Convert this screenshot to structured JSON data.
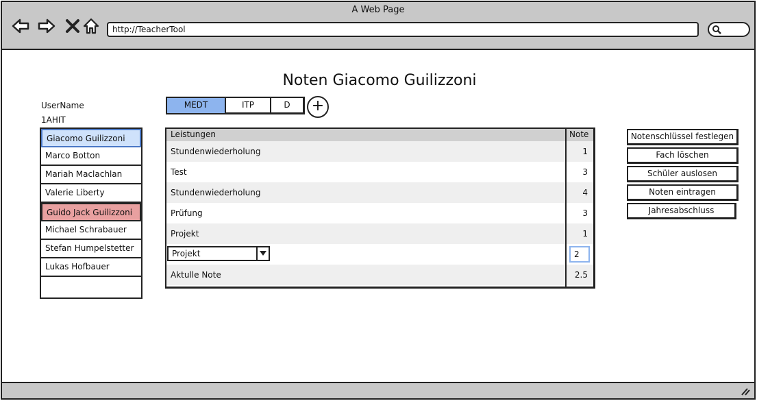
{
  "window": {
    "title": "A Web Page"
  },
  "browser": {
    "url": "http://TeacherTool"
  },
  "page": {
    "title": "Noten Giacomo Guilizzoni"
  },
  "user": {
    "name": "UserName",
    "class": "1AHIT"
  },
  "students": [
    "Giacomo Guilizzoni",
    "Marco Botton",
    "Mariah Maclachlan",
    "Valerie Liberty",
    "Guido Jack Guilizzoni",
    "Michael Schrabauer",
    "Stefan Humpelstetter",
    "Lukas Hofbauer",
    ""
  ],
  "tabs": [
    "MEDT",
    "ITP",
    "D"
  ],
  "add_tab_label": "+",
  "grid": {
    "headers": [
      "Leistungen",
      "Note"
    ],
    "rows": [
      {
        "label": "Stundenwiederholung",
        "value": "1"
      },
      {
        "label": "Test",
        "value": "3"
      },
      {
        "label": "Stundenwiederholung",
        "value": "4"
      },
      {
        "label": "Prüfung",
        "value": "3"
      },
      {
        "label": "Projekt",
        "value": "1"
      }
    ],
    "input_select": "Projekt",
    "input_value": "2",
    "summary": {
      "label": "Aktulle Note",
      "value": "2.5"
    }
  },
  "actions": [
    "Notenschlüssel festlegen",
    "Fach löschen",
    "Schüler auslosen",
    "Noten eintragen",
    "Jahresabschluss"
  ]
}
